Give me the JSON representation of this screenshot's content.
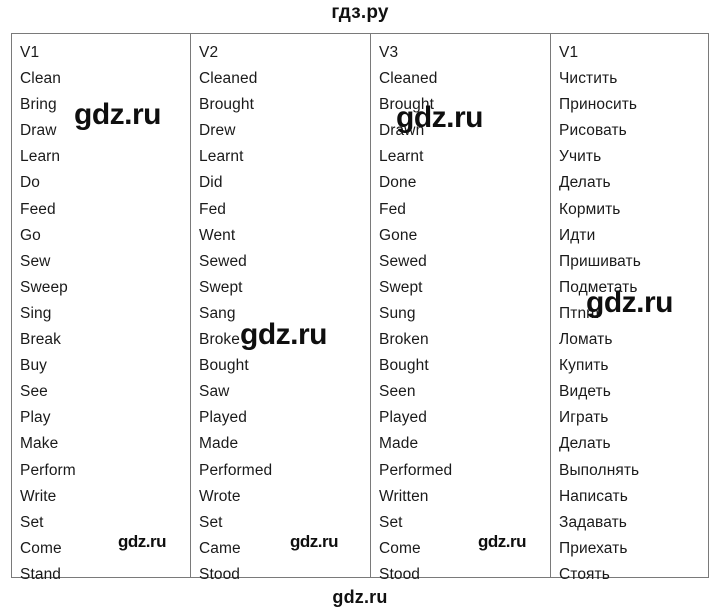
{
  "brand": {
    "top": "гдз.ру",
    "bottom": "gdz.ru"
  },
  "table": {
    "headers": [
      "V1",
      "V2",
      "V3",
      "V1"
    ],
    "columns": [
      {
        "header": "V1",
        "cells": [
          "Clean",
          "Bring",
          "Draw",
          "Learn",
          "Do",
          "Feed",
          "Go",
          "Sew",
          "Sweep",
          "Sing",
          "Break",
          "Buy",
          "See",
          "Play",
          "Make",
          "Perform",
          "Write",
          "Set",
          "Come",
          "Stand"
        ]
      },
      {
        "header": "V2",
        "cells": [
          "Cleaned",
          "Brought",
          "Drew",
          "Learnt",
          "Did",
          "Fed",
          "Went",
          "Sewed",
          "Swept",
          "Sang",
          "Broke",
          "Bought",
          "Saw",
          "Played",
          "Made",
          "Performed",
          "Wrote",
          "Set",
          "Came",
          "Stood"
        ]
      },
      {
        "header": "V3",
        "cells": [
          "Cleaned",
          "Brought",
          "Drawn",
          "Learnt",
          "Done",
          "Fed",
          "Gone",
          "Sewed",
          "Swept",
          "Sung",
          "Broken",
          "Bought",
          "Seen",
          "Played",
          "Made",
          "Performed",
          "Written",
          "Set",
          "Come",
          "Stood"
        ]
      },
      {
        "header": "V1",
        "cells": [
          "Чистить",
          "Приносить",
          "Рисовать",
          "Учить",
          "Делать",
          "Кормить",
          "Идти",
          "Пришивать",
          "Подметать",
          "Птnm",
          "Ломать",
          "Купить",
          "Видеть",
          "Играть",
          "Делать",
          "Выполнять",
          "Написать",
          "Задавать",
          "Приехать",
          "Стоять"
        ]
      }
    ]
  },
  "watermarks": {
    "a": "gdz.ru",
    "b": "gdz.ru",
    "c": "gdz.ru",
    "d": "gdz.ru",
    "e": "gdz.ru",
    "f": "gdz.ru",
    "g": "gdz.ru"
  },
  "colors": {
    "text": "#1a1a1a",
    "border": "#7a7a7a",
    "watermark": "#0f0f0f",
    "background": "#ffffff"
  }
}
